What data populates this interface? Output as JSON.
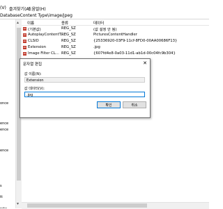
{
  "menu": {
    "view": "(V)",
    "favorites": "즐겨찾기(A)",
    "help": "도움말(H)"
  },
  "address": "DatabaseContent Type\\image/jpeg",
  "tree": {
    "items": [
      "once",
      "ence",
      "ence",
      "ence",
      "s",
      "tt",
      "roto"
    ]
  },
  "list": {
    "headers": {
      "name": "이름",
      "type": "종류",
      "data": "데이터"
    },
    "rows": [
      {
        "name": "(기본값)",
        "type": "REG_SZ",
        "data": "(값 설정 안 됨)",
        "icon": "string-value-icon"
      },
      {
        "name": "AutoplayContentT...",
        "type": "REG_SZ",
        "data": "PicturesContentHandler",
        "icon": "string-value-icon"
      },
      {
        "name": "CLSID",
        "type": "REG_SZ",
        "data": "{25336920-03F9-11cf-8FD0-00AA00686F13}",
        "icon": "string-value-icon"
      },
      {
        "name": "Extension",
        "type": "REG_SZ",
        "data": ".jpg",
        "icon": "string-value-icon"
      },
      {
        "name": "Image Filter CL...",
        "type": "REG_SZ",
        "data": "{607fd4e8-0a03-11d1-ab1d-00c04fc9b304}",
        "icon": "string-value-icon"
      }
    ]
  },
  "dialog": {
    "title": "문자열 편집",
    "close": "✕",
    "name_label": "값 이름(N):",
    "name_value": "Extension",
    "data_label": "값 데이터(V):",
    "data_value": ".jpg",
    "ok": "확인",
    "cancel": "취소"
  },
  "colors": {
    "accent": "#0078d7",
    "string_icon": "#c0392b"
  }
}
